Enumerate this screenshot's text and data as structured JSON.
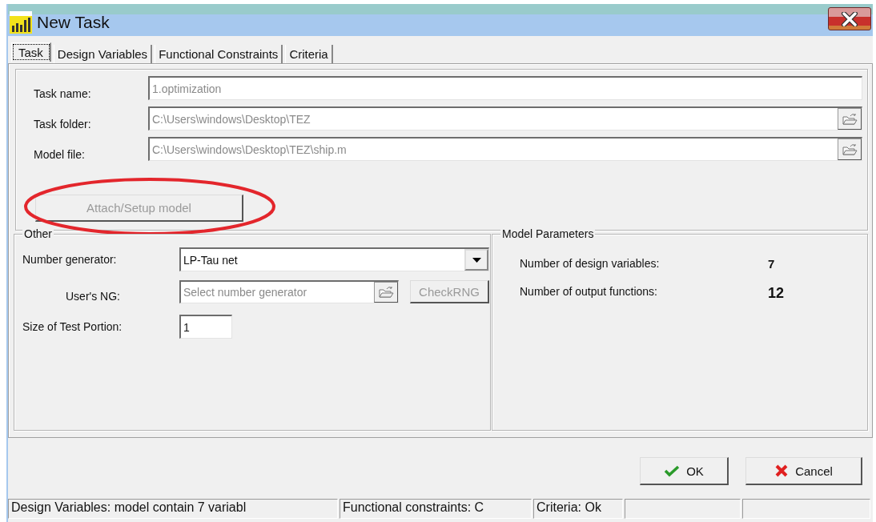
{
  "window": {
    "title": "New Task"
  },
  "tabs": [
    {
      "label": "Task",
      "selected": true
    },
    {
      "label": "Design Variables",
      "selected": false
    },
    {
      "label": "Functional Constraints",
      "selected": false
    },
    {
      "label": "Criteria",
      "selected": false
    }
  ],
  "task_fields": [
    {
      "label": "Task name:",
      "value": "1.optimization",
      "disabled": true,
      "browse": false
    },
    {
      "label": "Task folder:",
      "value": "C:\\Users\\windows\\Desktop\\TEZ",
      "disabled": true,
      "browse": true
    },
    {
      "label": "Model file:",
      "value": "C:\\Users\\windows\\Desktop\\TEZ\\ship.m",
      "disabled": true,
      "browse": true
    }
  ],
  "attach_button": {
    "label": "Attach/Setup model",
    "disabled": true
  },
  "other": {
    "title": "Other",
    "number_generator": {
      "label": "Number generator:",
      "value": "LP-Tau net"
    },
    "users_ng": {
      "label": "User's NG:",
      "placeholder": "Select number generator",
      "disabled": true
    },
    "check_button": {
      "label": "CheckRNG",
      "disabled": true
    },
    "test_portion": {
      "label": "Size of Test Portion:",
      "value": "1"
    }
  },
  "model_parameters": {
    "title": "Model Parameters",
    "rows": [
      {
        "label": "Number of design variables:",
        "value": "7"
      },
      {
        "label": "Number of output functions:",
        "value": "12"
      }
    ]
  },
  "buttons": [
    {
      "label": "OK",
      "kind": "ok"
    },
    {
      "label": "Cancel",
      "kind": "cancel"
    }
  ],
  "status_bar": [
    "Design Variables: model contain 7 variabl",
    "Functional constraints: C",
    "Criteria: Ok"
  ]
}
